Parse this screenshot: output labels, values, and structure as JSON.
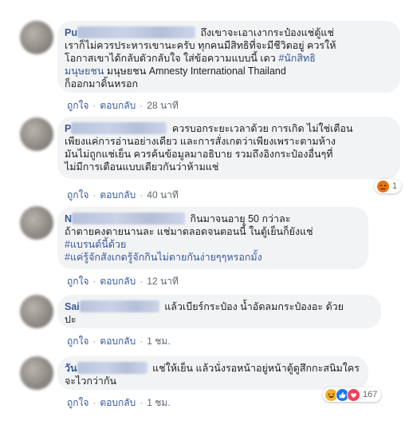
{
  "comments": [
    {
      "author_visible": "Pu",
      "lines": [
        "ถึงเขาจะเอาเงากระป๋องแช่ตู้แช่",
        "เราก็ไม่ควรประหารเขานะครับ ทุกคนมีสิทธิที่จะมีชีวิตอยู่ ควรให้",
        "โอกาสเขาได้กลับตัวกลับใจ ใส่ข้อความแบบนี้ เดว",
        "มนุษยชน Amnesty International Thailand",
        "ก็ออกมาดิ้นหรอก"
      ],
      "hashtag": "#นักสิทธิ",
      "hashtag_cont": "มนุษยชน",
      "like_label": "ถูกใจ",
      "reply_label": "ตอบกลับ",
      "time": "28 นาที"
    },
    {
      "author_visible": "P",
      "lines": [
        "ควรบอกระยะเวลาด้วย การเกิด ไม่ใช่เตือน",
        "เพียงแค่การอ่านอย่างเดียว และการสั่งเกตว่าเพียงเพราะตามห้าง",
        "มันไม่ถูกแช่เย็น ควรค้นข้อมูลมาอธิบาย รวมถึงอิงกระป๋องอื่นๆที่",
        "ไม่มีการเตือนแบบเดียวกันว่าห้ามแช่"
      ],
      "like_label": "ถูกใจ",
      "reply_label": "ตอบกลับ",
      "time": "40 นาที",
      "reaction_count": "1"
    },
    {
      "author_visible": "N",
      "lines": [
        "กินมาจนอายุ 50 กว่าละ",
        "ถ้าตายคงตายนานละ แช่มาตลอดจนตอนนี้ ในตู้เย็นก็ยังแช่"
      ],
      "hashtags": [
        "#แบรนด์นี้ด้วย",
        "#แค่รู้จักสังเกตรู้จักกินไม่ตายกันง่ายๆๆหรอกมั้ง"
      ],
      "like_label": "ถูกใจ",
      "reply_label": "ตอบกลับ",
      "time": "12 นาที"
    },
    {
      "author_visible": "Sai",
      "lines": [
        "แล้วเบียร์กระป๋อง น้ำอัดลมกระป๋องอะ ด้วย",
        "ปะ"
      ],
      "like_label": "ถูกใจ",
      "reply_label": "ตอบกลับ",
      "time": "1 ชม."
    },
    {
      "author_visible": "วัน",
      "lines": [
        "แช่ให้เย็น แล้วนั่งรอหน้าอยู่หน้าตู้ดูสึกกะสนิมใคร",
        "จะไวกว่ากัน"
      ],
      "like_label": "ถูกใจ",
      "reply_label": "ตอบกลับ",
      "time": "1 ชม.",
      "reaction_count": "167"
    }
  ],
  "colors": {
    "link": "#385898",
    "bubble": "#f2f3f5",
    "meta": "#606770"
  }
}
